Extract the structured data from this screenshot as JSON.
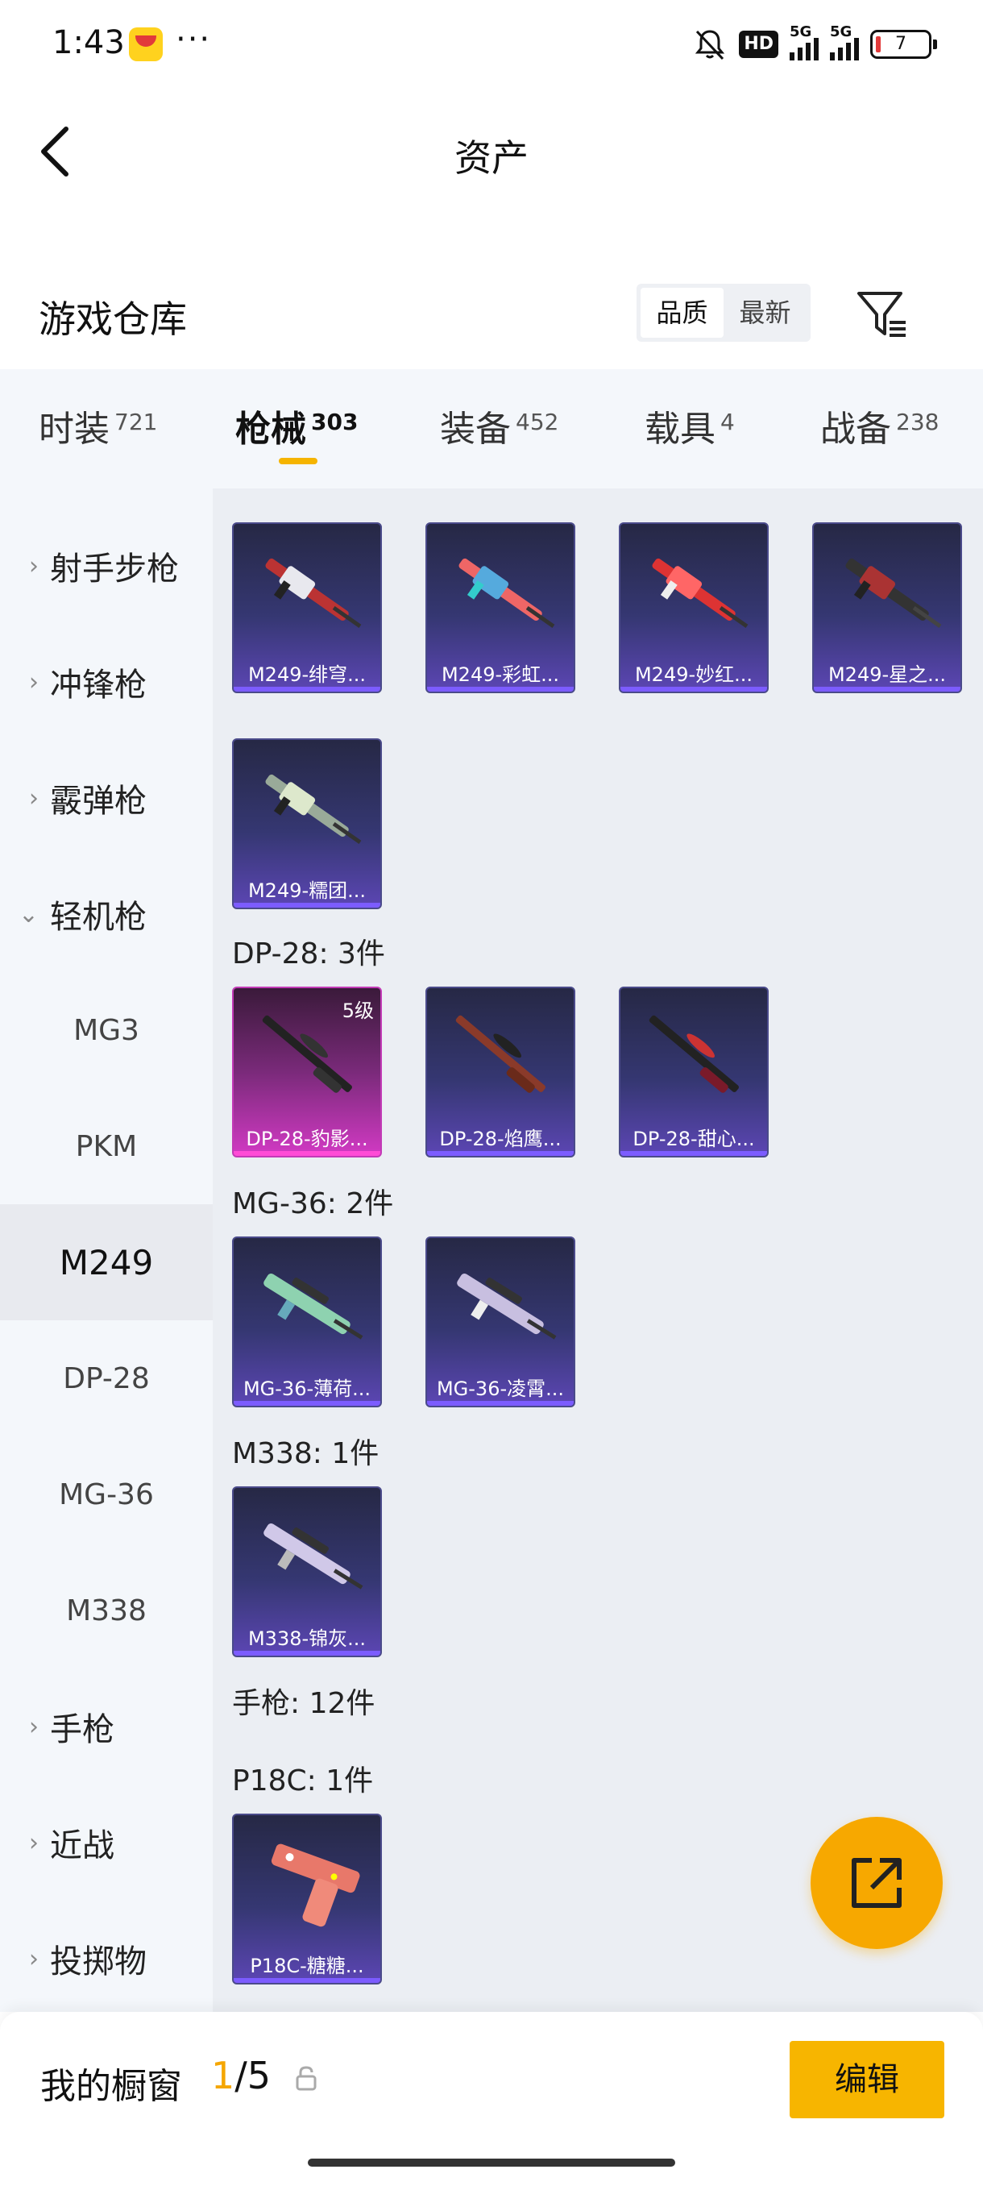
{
  "status_bar": {
    "time": "1:43",
    "dots": "···",
    "hd": "HD",
    "net1": "5G",
    "net2": "5G",
    "battery": "7"
  },
  "header": {
    "title": "资产"
  },
  "section": {
    "title": "游戏仓库",
    "sort_options": [
      "品质",
      "最新"
    ]
  },
  "tabs": [
    {
      "label": "时装",
      "count": "721"
    },
    {
      "label": "枪械",
      "count": "303"
    },
    {
      "label": "装备",
      "count": "452"
    },
    {
      "label": "载具",
      "count": "4"
    },
    {
      "label": "战备",
      "count": "238"
    }
  ],
  "sidebar": {
    "categories": [
      "射手步枪",
      "冲锋枪",
      "霰弹枪",
      "轻机枪"
    ],
    "sub_items": [
      "MG3",
      "PKM",
      "M249",
      "DP-28",
      "MG-36",
      "M338"
    ],
    "more_categories": [
      "手枪",
      "近战",
      "投掷物"
    ]
  },
  "groups": {
    "m249": {
      "items": [
        "M249-绯穹...",
        "M249-彩虹...",
        "M249-妙红...",
        "M249-星之...",
        "M249-糯团..."
      ]
    },
    "dp28": {
      "label": "DP-28: 3件",
      "level": "5级",
      "items": [
        "DP-28-豹影...",
        "DP-28-焰鹰...",
        "DP-28-甜心..."
      ]
    },
    "mg36": {
      "label": "MG-36: 2件",
      "items": [
        "MG-36-薄荷...",
        "MG-36-凌霄..."
      ]
    },
    "m338": {
      "label": "M338: 1件",
      "items": [
        "M338-锦灰..."
      ]
    },
    "pistol": {
      "label": "手枪: 12件"
    },
    "p18c": {
      "label": "P18C: 1件",
      "items": [
        "P18C-糖糖..."
      ]
    }
  },
  "bottom": {
    "label": "我的橱窗",
    "current": "1",
    "total": "/5",
    "edit_label": "编辑"
  },
  "colors": {
    "accent": "#f7b500",
    "card_purple": "#353772",
    "card_pink": "#d23ac4"
  }
}
